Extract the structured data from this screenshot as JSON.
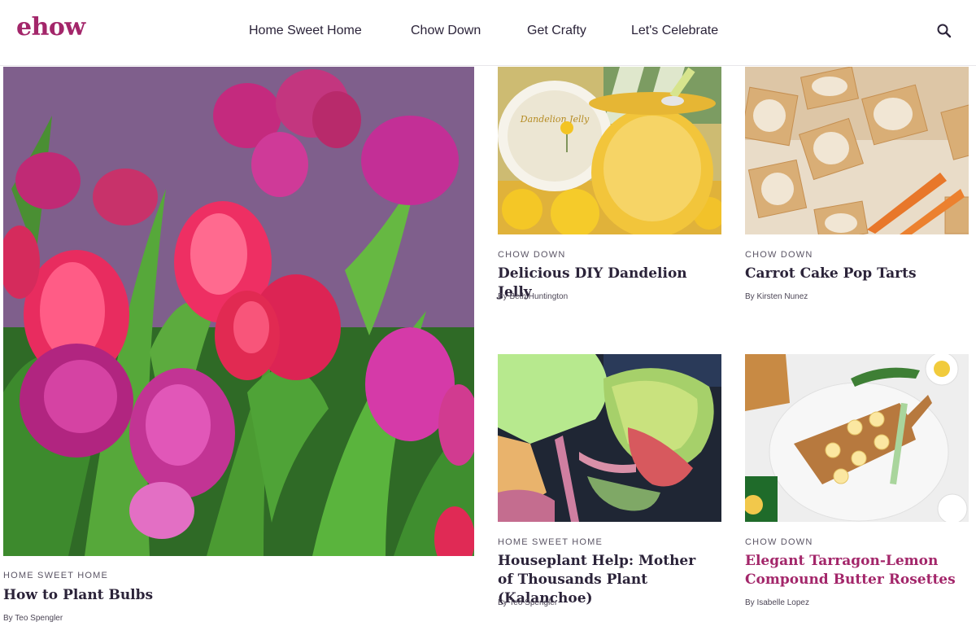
{
  "header": {
    "logo": "ehow",
    "nav": [
      {
        "label": "Home Sweet Home"
      },
      {
        "label": "Chow Down"
      },
      {
        "label": "Get Crafty"
      },
      {
        "label": "Let's Celebrate"
      }
    ]
  },
  "articles": [
    {
      "category": "Home Sweet Home",
      "title": "How to Plant Bulbs",
      "byline": "By Teo Spengler"
    },
    {
      "category": "Chow Down",
      "title": "Delicious DIY Dandelion Jelly",
      "byline": "By Beth Huntington"
    },
    {
      "category": "Chow Down",
      "title": "Carrot Cake Pop Tarts",
      "byline": "By Kirsten Nunez"
    },
    {
      "category": "Home Sweet Home",
      "title": "Houseplant Help: Mother of Thousands Plant (Kalanchoe)",
      "byline": "By Teo Spengler"
    },
    {
      "category": "Chow Down",
      "title": "Elegant Tarragon-Lemon Compound Butter Rosettes",
      "byline": "By Isabelle Lopez"
    }
  ],
  "images": {
    "jar_label": "Dandelion Jelly"
  },
  "colors": {
    "brand": "#a3266a",
    "text": "#2b2339",
    "hovered_title": "#a3266a"
  },
  "icons": [
    "search-icon"
  ]
}
